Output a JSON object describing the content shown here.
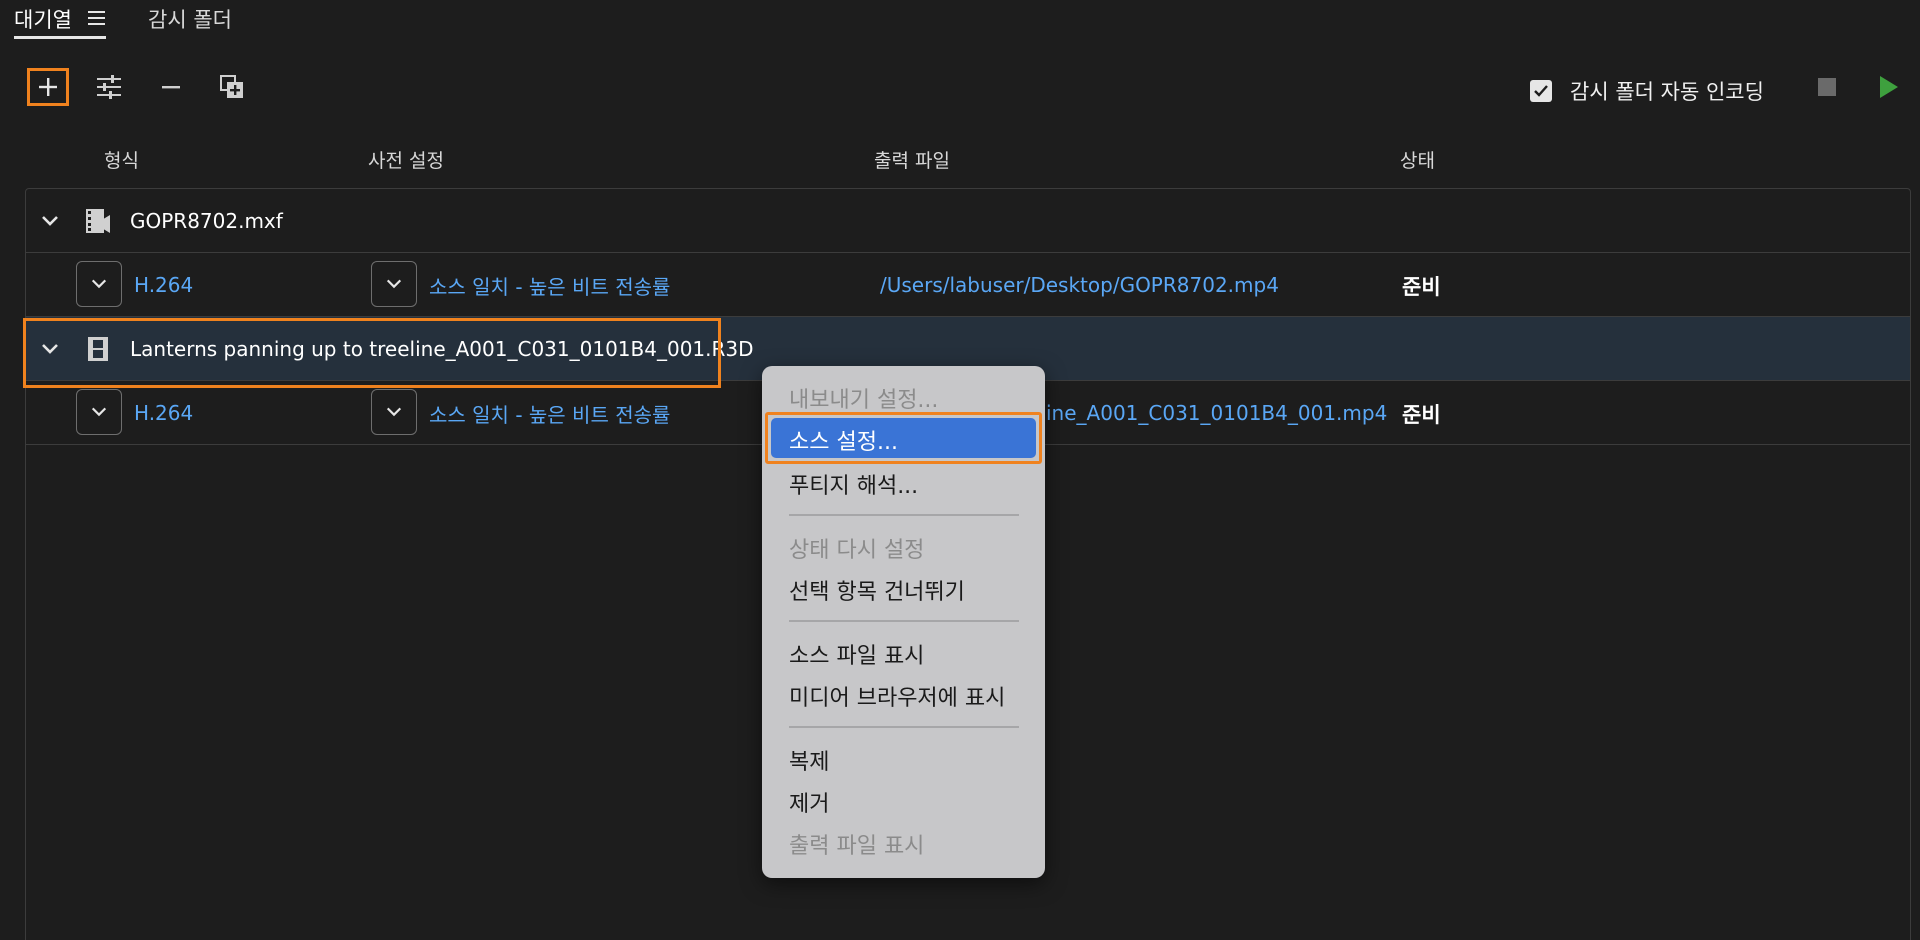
{
  "tabs": {
    "queue_label": "대기열",
    "watch_label": "감시 폴더"
  },
  "toolbar": {
    "add_icon": "plus-icon",
    "settings_icon": "sliders-icon",
    "remove_icon": "minus-icon",
    "duplicate_icon": "duplicate-icon",
    "auto_encode_label": "감시 폴더 자동 인코딩",
    "auto_encode_checked": true
  },
  "columns": {
    "format": "형식",
    "preset": "사전 설정",
    "output": "출력 파일",
    "status": "상태"
  },
  "queue": {
    "items": [
      {
        "name": "GOPR8702.mxf",
        "format": "H.264",
        "preset": "소스 일치 - 높은 비트 전송률",
        "output": "/Users/labuser/Desktop/GOPR8702.mp4",
        "status": "준비"
      },
      {
        "name": "Lanterns panning up to treeline_A001_C031_0101B4_001.R3D",
        "format": "H.264",
        "preset": "소스 일치 - 높은 비트 전송률",
        "output": "ine_A001_C031_0101B4_001.mp4",
        "status": "준비"
      }
    ]
  },
  "context_menu": {
    "export_settings": "내보내기 설정...",
    "source_settings": "소스 설정...",
    "footage_interpret": "푸티지 해석...",
    "reset_status": "상태 다시 설정",
    "skip_selected": "선택 항목 건너뛰기",
    "show_source": "소스 파일 표시",
    "show_in_browser": "미디어 브라우저에 표시",
    "duplicate": "복제",
    "remove": "제거",
    "show_output": "출력 파일 표시"
  },
  "colors": {
    "accent_orange": "#f0821e",
    "link_blue": "#5aa7f5",
    "menu_highlight": "#3a74d6",
    "play_green": "#3ea03e"
  }
}
